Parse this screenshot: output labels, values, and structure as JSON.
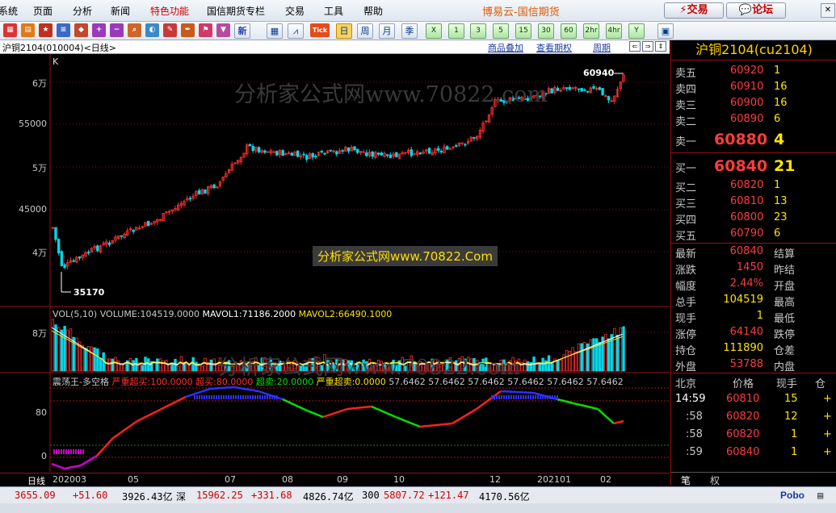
{
  "menu": {
    "items": [
      "系统",
      "页面",
      "分析",
      "新闻",
      "特色功能",
      "国信期货专栏",
      "交易",
      "工具",
      "帮助"
    ],
    "brand": "博易云-国信期货",
    "trade_button": "交易",
    "forum_button": "论坛"
  },
  "toolbar": {
    "tick_label": "Tick",
    "periods": [
      "日",
      "周",
      "月",
      "季",
      "X",
      "1",
      "3",
      "5",
      "15",
      "30",
      "60",
      "2hr",
      "4hr",
      "Y"
    ],
    "active_period": "日",
    "new_label": "新"
  },
  "chart_header": {
    "symbol": "沪铜2104(010004)<日线>",
    "overlay_link": "商品叠加",
    "options_link": "查看期权",
    "period_link": "周期"
  },
  "price_panel": {
    "k_label": "K",
    "y_labels": [
      "6万",
      "55000",
      "5万",
      "45000",
      "4万"
    ],
    "high_label": "60940",
    "low_label": "35170",
    "watermark": "分析家公式网www.70822.com",
    "watermark_box": "分析家公式网www.70822.Com"
  },
  "volume_panel": {
    "title": "VOL(5,10)",
    "volume": "VOLUME:104519.0000",
    "mavol1": "MAVOL1:71186.2000",
    "mavol2": "MAVOL2:66490.1000",
    "y_label": "8万"
  },
  "osc_panel": {
    "name": "震荡王-多空格",
    "severe_overbought": "严重超买:100.0000",
    "overbought": "超买:80.0000",
    "oversold": "超卖:20.0000",
    "severe_oversold": "严重超卖:0.0000",
    "values": "57.6462 57.6462 57.6462 57.6462 57.6462 57.6462",
    "y_labels": [
      "80",
      "0"
    ]
  },
  "x_axis": {
    "mode_label": "日线",
    "labels": [
      "202003",
      "05",
      "07",
      "08",
      "09",
      "10",
      "12",
      "202101",
      "02"
    ]
  },
  "quote": {
    "title": "沪铜2104(cu2104)",
    "asks": [
      {
        "label": "卖五",
        "price": "60920",
        "vol": "1"
      },
      {
        "label": "卖四",
        "price": "60910",
        "vol": "16"
      },
      {
        "label": "卖三",
        "price": "60900",
        "vol": "16"
      },
      {
        "label": "卖二",
        "price": "60890",
        "vol": "6"
      },
      {
        "label": "卖一",
        "price": "60880",
        "vol": "4"
      }
    ],
    "bids": [
      {
        "label": "买一",
        "price": "60840",
        "vol": "21"
      },
      {
        "label": "买二",
        "price": "60820",
        "vol": "1"
      },
      {
        "label": "买三",
        "price": "60810",
        "vol": "13"
      },
      {
        "label": "买四",
        "price": "60800",
        "vol": "23"
      },
      {
        "label": "买五",
        "price": "60790",
        "vol": "6"
      }
    ],
    "stats": [
      {
        "label": "最新",
        "value": "60840",
        "label2": "结算"
      },
      {
        "label": "涨跌",
        "value": "1450",
        "label2": "昨结"
      },
      {
        "label": "幅度",
        "value": "2.44%",
        "label2": "开盘"
      },
      {
        "label": "总手",
        "value": "104519",
        "label2": "最高"
      },
      {
        "label": "现手",
        "value": "1",
        "label2": "最低"
      },
      {
        "label": "涨停",
        "value": "64140",
        "label2": "跌停"
      },
      {
        "label": "持仓",
        "value": "111890",
        "label2": "仓差"
      },
      {
        "label": "外盘",
        "value": "53788",
        "label2": "内盘"
      }
    ],
    "ticks_header": [
      "北京",
      "价格",
      "现手",
      "仓"
    ],
    "ticks": [
      {
        "time": "14:59",
        "price": "60810",
        "vol": "15",
        "flag": "+"
      },
      {
        "time": ":58",
        "price": "60820",
        "vol": "12",
        "flag": "+"
      },
      {
        "time": ":58",
        "price": "60820",
        "vol": "1",
        "flag": "+"
      },
      {
        "time": ":59",
        "price": "60840",
        "vol": "1",
        "flag": "+"
      }
    ],
    "tabs": [
      "笔",
      "权"
    ]
  },
  "status_bar": {
    "items": [
      {
        "value": "3655.09",
        "color": "#d00000"
      },
      {
        "value": "+51.60",
        "color": "#d00000"
      },
      {
        "value": "3926.43亿",
        "color": "#000"
      },
      {
        "value": "深",
        "color": "#000"
      },
      {
        "value": "15962.25",
        "color": "#d00000"
      },
      {
        "value": "+331.68",
        "color": "#d00000"
      },
      {
        "value": "4826.74亿",
        "color": "#000"
      },
      {
        "value": "300",
        "color": "#000"
      },
      {
        "value": "5807.72",
        "color": "#d00000"
      },
      {
        "value": "+121.47",
        "color": "#d00000"
      },
      {
        "value": "4170.56亿",
        "color": "#000"
      }
    ],
    "brand": "Pobo"
  }
}
